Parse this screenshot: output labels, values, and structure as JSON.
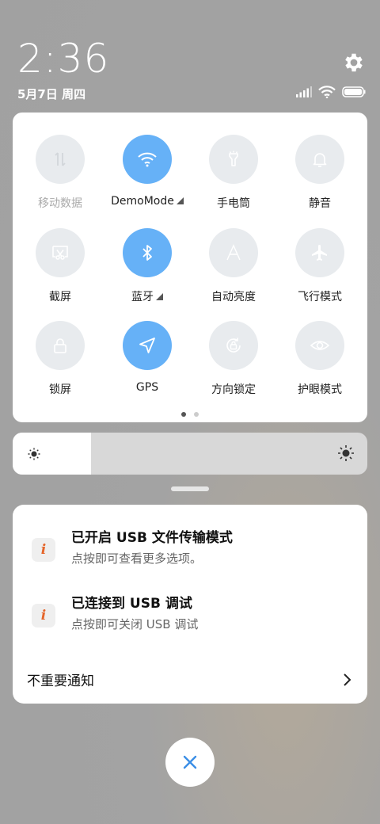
{
  "status_bar": {
    "time": "2:36",
    "date": "5月7日 周四",
    "icons": [
      "signal-icon",
      "wifi-icon",
      "battery-icon"
    ]
  },
  "settings_icon": "gear-icon",
  "quick_toggles": {
    "page_count": 2,
    "active_page": 1,
    "tiles": [
      {
        "label": "移动数据",
        "icon": "mobile-data-icon",
        "state": "disabled"
      },
      {
        "label": "DemoMode",
        "icon": "wifi-icon",
        "state": "on",
        "expandable": true
      },
      {
        "label": "手电筒",
        "icon": "flashlight-icon",
        "state": "off"
      },
      {
        "label": "静音",
        "icon": "bell-icon",
        "state": "off"
      },
      {
        "label": "截屏",
        "icon": "screenshot-icon",
        "state": "off"
      },
      {
        "label": "蓝牙",
        "icon": "bluetooth-icon",
        "state": "on",
        "expandable": true
      },
      {
        "label": "自动亮度",
        "icon": "auto-brightness-icon",
        "state": "off"
      },
      {
        "label": "飞行模式",
        "icon": "airplane-icon",
        "state": "off"
      },
      {
        "label": "锁屏",
        "icon": "lock-icon",
        "state": "off"
      },
      {
        "label": "GPS",
        "icon": "location-icon",
        "state": "on"
      },
      {
        "label": "方向锁定",
        "icon": "rotation-lock-icon",
        "state": "off"
      },
      {
        "label": "护眼模式",
        "icon": "eye-icon",
        "state": "off"
      }
    ]
  },
  "brightness": {
    "level": 0.22,
    "low_icon": "brightness-low-icon",
    "high_icon": "brightness-high-icon"
  },
  "notifications": {
    "items": [
      {
        "title": "已开启 USB 文件传输模式",
        "subtitle": "点按即可查看更多选项。",
        "icon": "info-icon"
      },
      {
        "title": "已连接到 USB 调试",
        "subtitle": "点按即可关闭 USB 调试",
        "icon": "info-icon"
      }
    ],
    "unimportant_label": "不重要通知"
  },
  "colors": {
    "accent": "#66b1f7",
    "info_icon": "#e5652a"
  }
}
